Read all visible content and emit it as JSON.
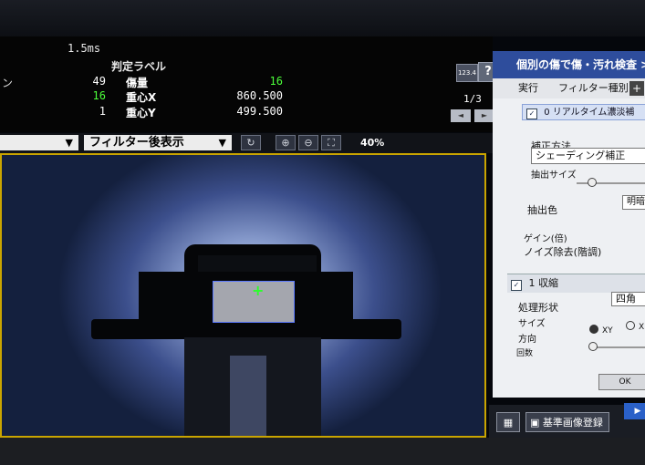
{
  "results": {
    "time": "1.5ms",
    "judge_label": "判定ラベル",
    "rows": [
      {
        "mark": "ン",
        "num": "49",
        "label": "傷量",
        "value": "16"
      },
      {
        "mark": "",
        "num": "16",
        "label": "重心X",
        "value": "860.500"
      },
      {
        "mark": "",
        "num": "1",
        "label": "重心Y",
        "value": "499.500"
      }
    ]
  },
  "nav": {
    "btn_num": "123.4",
    "help": "?",
    "page": "1/3",
    "prev": "◄",
    "next": "►"
  },
  "toolbar": {
    "view_mode": "フィルター後表示",
    "zoom_text": "40%"
  },
  "panel": {
    "title": "個別の傷で傷・汚れ検査 > 個",
    "tab_run": "実行",
    "tab_filter": "フィルター種別",
    "section1": "0  リアルタイム濃淡補",
    "correction_label": "補正方法",
    "correction_value": "シェーディング補正",
    "extract_size": "抽出サイズ",
    "extract_color_label": "抽出色",
    "extract_color_value": "明暗",
    "gain": "ゲイン(倍)",
    "noise": "ノイズ除去(階調)",
    "section2": "1  収縮",
    "shape_label": "処理形状",
    "shape_value": "四角",
    "size_label": "サイズ",
    "direction_label": "方向",
    "dir_xy": "XY",
    "dir_x": "X",
    "count_label": "回数",
    "ok": "OK"
  },
  "bottom": {
    "register": "基準画像登録"
  },
  "colors": {
    "accent": "#2e4d9c",
    "highlight": "#4cff3a",
    "frame": "#c9a400"
  }
}
